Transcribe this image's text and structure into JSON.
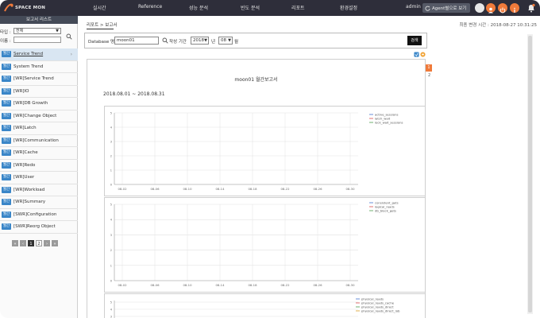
{
  "brand": {
    "logo_text": "SPACE MON"
  },
  "nav": {
    "items": [
      "실시간",
      "Reference",
      "성능 분석",
      "빈도 분석",
      "리포트",
      "환경설정"
    ],
    "user": "admin",
    "agent_button": "Agent별으로 보기"
  },
  "sidebar": {
    "title": "보고서 리스트",
    "filter_type_label": "타입 :",
    "filter_type_value": "전체",
    "filter_name_label": "이름 :",
    "items": [
      {
        "badge": "월간",
        "label": "Service Trend"
      },
      {
        "badge": "월간",
        "label": "System Trend"
      },
      {
        "badge": "월간",
        "label": "[WR]Service Trend"
      },
      {
        "badge": "월간",
        "label": "[WR]IO"
      },
      {
        "badge": "월간",
        "label": "[WR]DB Growth"
      },
      {
        "badge": "월간",
        "label": "[WR]Change Object"
      },
      {
        "badge": "월간",
        "label": "[WR]Latch"
      },
      {
        "badge": "월간",
        "label": "[WR]Communication"
      },
      {
        "badge": "월간",
        "label": "[WR]Cache"
      },
      {
        "badge": "월간",
        "label": "[WR]Redo"
      },
      {
        "badge": "월간",
        "label": "[WR]User"
      },
      {
        "badge": "월간",
        "label": "[WR]Workload"
      },
      {
        "badge": "월간",
        "label": "[WR]Summary"
      },
      {
        "badge": "월간",
        "label": "[SWR]Configuration"
      },
      {
        "badge": "월간",
        "label": "[SWR]Reorg Object"
      }
    ],
    "pager": {
      "first": "«",
      "prev": "‹",
      "pages": [
        "1",
        "2"
      ],
      "next": "›",
      "last": "»",
      "current": "1"
    }
  },
  "main": {
    "breadcrumb": "리포트 > 보고서",
    "last_modified": "최종 변경 시간 : 2018-08-27 10:31:25",
    "filter": {
      "db_label": "Database 명",
      "db_value": "moon01",
      "period_label": "작성 기간",
      "year_value": "2018",
      "year_unit": "년",
      "month_value": "08",
      "month_unit": "월",
      "search_button": "검색"
    },
    "report": {
      "title": "moon01 월간보고서",
      "date_range": "2018.08.01 ~ 2018.08.31",
      "page_tabs": [
        "1",
        "2"
      ]
    }
  },
  "colors": {
    "badge": "#3a86c8",
    "topbar": "#2e2e3a",
    "active_tab": "#f07a3a"
  },
  "chart_data": [
    {
      "type": "line",
      "x_ticks": [
        "08-02",
        "08-06",
        "08-10",
        "08-14",
        "08-18",
        "08-22",
        "08-26",
        "08-30"
      ],
      "y_ticks": [
        "0",
        "1",
        "2",
        "3",
        "4",
        "5"
      ],
      "ylim": [
        0,
        5
      ],
      "series": [
        {
          "name": "active_sessions",
          "color": "#6a8fd8",
          "values": []
        },
        {
          "name": "latch_wait",
          "color": "#e07070",
          "values": []
        },
        {
          "name": "lock_wait_sessions",
          "color": "#70b070",
          "values": []
        }
      ]
    },
    {
      "type": "line",
      "x_ticks": [
        "08-02",
        "08-06",
        "08-10",
        "08-14",
        "08-18",
        "08-22",
        "08-26",
        "08-30"
      ],
      "y_ticks": [
        "0",
        "1",
        "2",
        "3",
        "4",
        "5"
      ],
      "ylim": [
        0,
        5
      ],
      "series": [
        {
          "name": "consistent_gets",
          "color": "#6a8fd8",
          "values": []
        },
        {
          "name": "logical_reads",
          "color": "#e07070",
          "values": []
        },
        {
          "name": "db_block_gets",
          "color": "#70b070",
          "values": []
        }
      ]
    },
    {
      "type": "line",
      "x_ticks": [],
      "y_ticks": [
        "2",
        "3",
        "4",
        "5"
      ],
      "ylim": [
        0,
        5
      ],
      "series": [
        {
          "name": "physical_reads",
          "color": "#6a8fd8",
          "values": []
        },
        {
          "name": "physical_reads_cache",
          "color": "#e07070",
          "values": []
        },
        {
          "name": "physical_reads_direct",
          "color": "#70b070",
          "values": []
        },
        {
          "name": "physical_reads_direct_lob",
          "color": "#e0b050",
          "values": []
        }
      ]
    }
  ]
}
